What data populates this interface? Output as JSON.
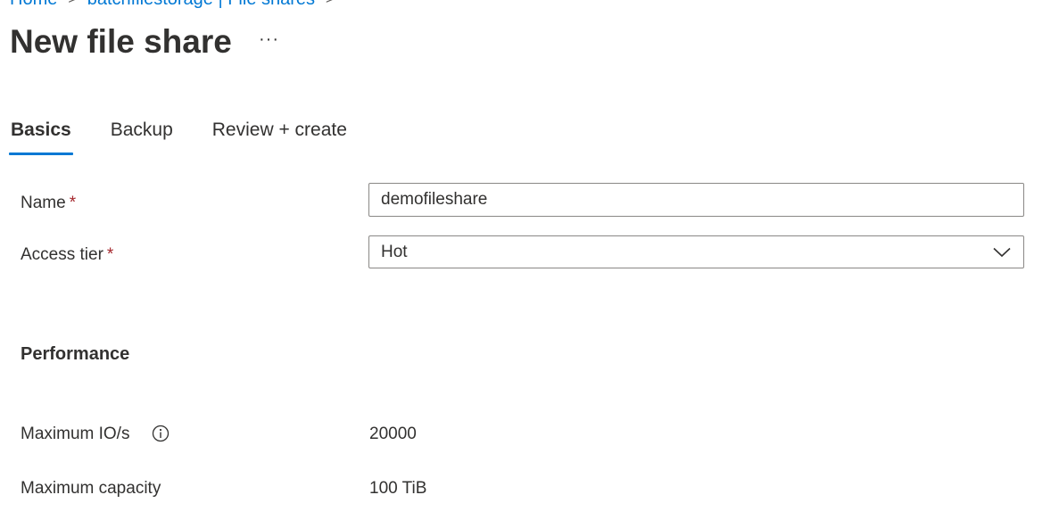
{
  "breadcrumb": {
    "home": "Home",
    "parent": "batchfilestorage | File shares",
    "separator": ">"
  },
  "title": "New file share",
  "more_label": "···",
  "tabs": [
    {
      "label": "Basics",
      "active": true
    },
    {
      "label": "Backup",
      "active": false
    },
    {
      "label": "Review + create",
      "active": false
    }
  ],
  "form": {
    "name_label": "Name",
    "name_value": "demofileshare",
    "access_tier_label": "Access tier",
    "access_tier_value": "Hot",
    "required_marker": "*"
  },
  "performance": {
    "heading": "Performance",
    "max_io_label": "Maximum IO/s",
    "max_io_value": "20000",
    "max_capacity_label": "Maximum capacity",
    "max_capacity_value": "100 TiB"
  },
  "colors": {
    "accent": "#0078d4",
    "required": "#a4262c",
    "text": "#323130",
    "border": "#8a8886"
  },
  "icons": {
    "info": "info-icon",
    "chevron": "chevron-down-icon",
    "more": "more-icon"
  }
}
